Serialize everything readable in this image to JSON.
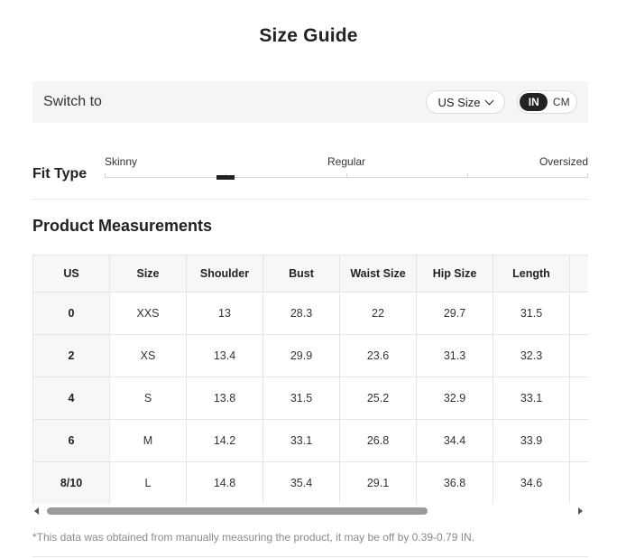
{
  "page_title": "Size Guide",
  "switch_bar": {
    "label": "Switch to",
    "size_select": "US Size",
    "units": {
      "active": "IN",
      "inactive": "CM"
    }
  },
  "fit_type": {
    "label": "Fit Type",
    "options": [
      "Skinny",
      "Regular",
      "Oversized"
    ]
  },
  "measurements": {
    "title": "Product Measurements",
    "headers": [
      "US",
      "Size",
      "Shoulder",
      "Bust",
      "Waist Size",
      "Hip Size",
      "Length",
      ""
    ],
    "rows": [
      [
        "0",
        "XXS",
        "13",
        "28.3",
        "22",
        "29.7",
        "31.5",
        ""
      ],
      [
        "2",
        "XS",
        "13.4",
        "29.9",
        "23.6",
        "31.3",
        "32.3",
        ""
      ],
      [
        "4",
        "S",
        "13.8",
        "31.5",
        "25.2",
        "32.9",
        "33.1",
        ""
      ],
      [
        "6",
        "M",
        "14.2",
        "33.1",
        "26.8",
        "34.4",
        "33.9",
        ""
      ],
      [
        "8/10",
        "L",
        "14.8",
        "35.4",
        "29.1",
        "36.8",
        "34.6",
        ""
      ]
    ]
  },
  "note": "*This data was obtained from manually measuring the product, it may be off by 0.39-0.79 IN."
}
